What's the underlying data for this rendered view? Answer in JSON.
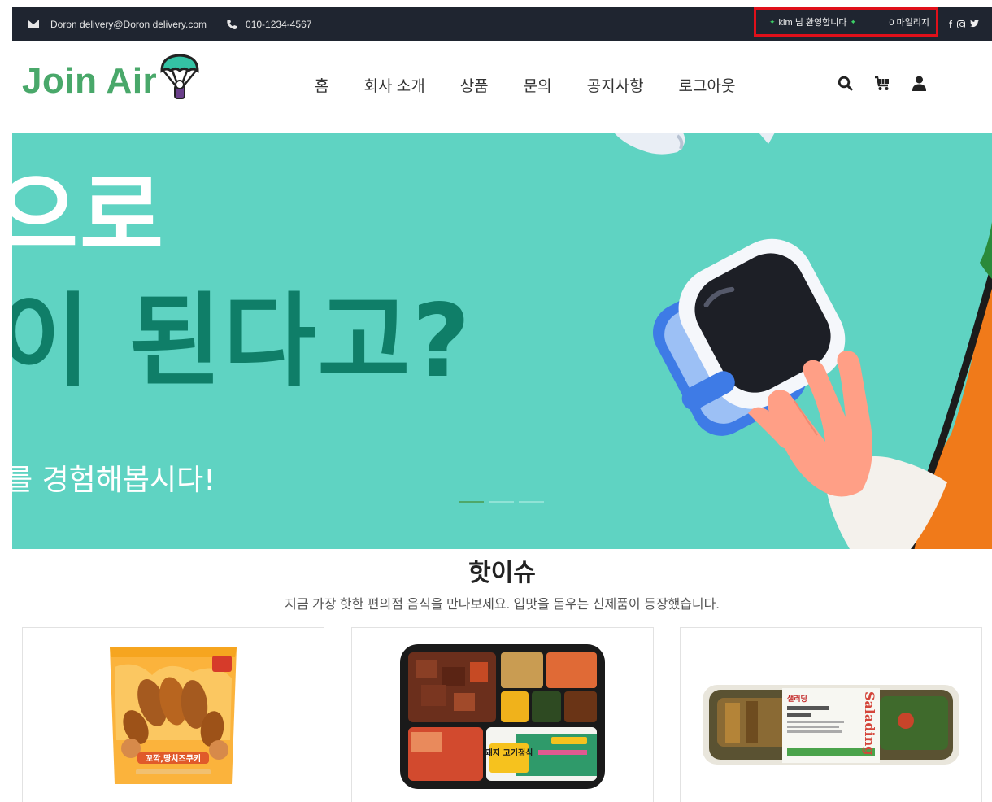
{
  "topbar": {
    "email": "Doron delivery@Doron delivery.com",
    "phone": "010-1234-4567",
    "welcome": "kim 님 환영합니다",
    "mileage": "0 마일리지",
    "social": [
      "facebook-icon",
      "instagram-icon",
      "twitter-icon"
    ]
  },
  "header": {
    "logo_text": "Join Air",
    "nav": [
      "홈",
      "회사 소개",
      "상품",
      "문의",
      "공지사항",
      "로그아웃"
    ],
    "icons": [
      "search-icon",
      "cart-icon",
      "user-icon"
    ]
  },
  "hero": {
    "line1": "으로",
    "line2": "이 된다고?",
    "line3": "를 경험해봅시다!",
    "slides": 3,
    "active_slide": 1
  },
  "hot_issue": {
    "title": "핫이슈",
    "subtitle": "지금 가장 핫한 편의점 음식을 만나보세요. 입맛을 돋우는 신제품이 등장했습니다.",
    "products": [
      {
        "image": "cookie-snack-package",
        "label_text": "꼬깍,땅치즈쿠키"
      },
      {
        "image": "lunch-box",
        "label_text": "돼지 고기정식"
      },
      {
        "image": "salad-package",
        "label_text": "Salading"
      }
    ]
  },
  "colors": {
    "topbar_bg": "#1f2530",
    "logo_green": "#49a86a",
    "hero_bg": "#5fd3c2",
    "hero_dark_text": "#0f7e68",
    "highlight_border": "#e0101a"
  }
}
